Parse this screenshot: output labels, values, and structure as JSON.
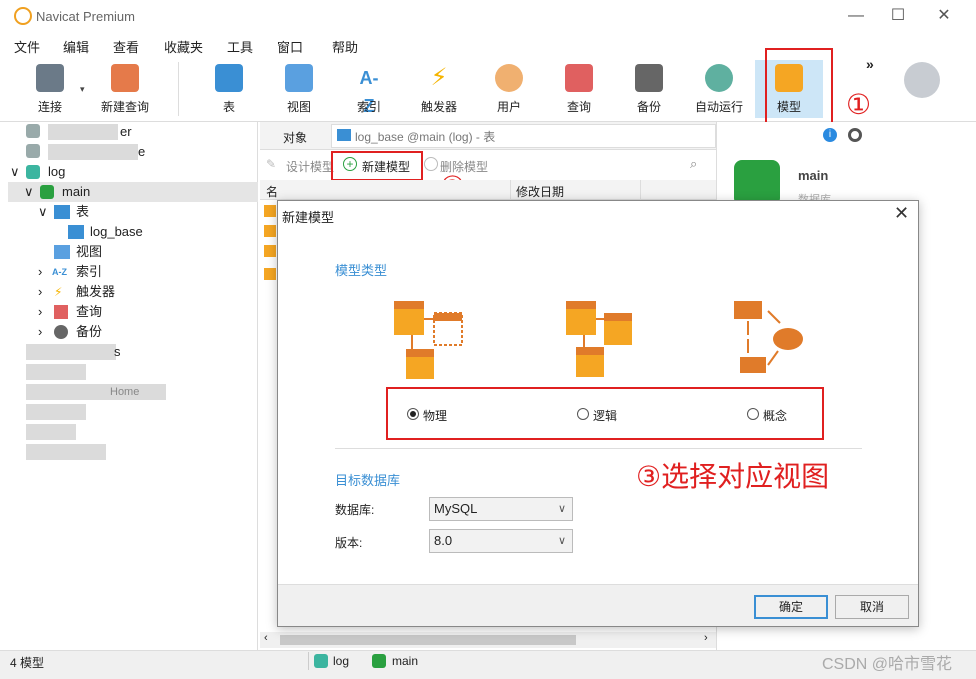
{
  "app": {
    "title": "Navicat Premium"
  },
  "window_controls": {
    "minimize": "—",
    "maximize": "☐",
    "close": "✕"
  },
  "menu": [
    "文件",
    "编辑",
    "查看",
    "收藏夹",
    "工具",
    "窗口",
    "帮助"
  ],
  "toolbar": {
    "connect": "连接",
    "new_query": "新建查询",
    "items": [
      "表",
      "视图",
      "索引",
      "触发器",
      "用户",
      "查询",
      "备份",
      "自动运行",
      "模型"
    ],
    "more": "»"
  },
  "sidebar": {
    "partial_text_1": "er",
    "partial_text_2": "e",
    "log": "log",
    "main": "main",
    "table_group": "表",
    "table_item": "log_base",
    "view": "视图",
    "index": "索引",
    "trigger": "触发器",
    "query": "查询",
    "backup": "备份",
    "partial_text_3": "s",
    "partial_text_4": "Home"
  },
  "objects": {
    "tab_label": "对象",
    "tab_title": "log_base @main (log) - 表",
    "design_model": "设计模型",
    "new_model": "新建模型",
    "delete_model": "删除模型",
    "col_name": "名",
    "col_modified": "修改日期"
  },
  "right_panel": {
    "db_name": "main",
    "db_sub": "数据库"
  },
  "status": {
    "count": "4 模型",
    "conn": "log",
    "db": "main",
    "watermark": "CSDN @哈市雪花"
  },
  "dialog": {
    "title": "新建模型",
    "close": "✕",
    "model_type": "模型类型",
    "options": [
      "物理",
      "逻辑",
      "概念"
    ],
    "selected": "物理",
    "target_db": "目标数据库",
    "db_label": "数据库:",
    "db_value": "MySQL",
    "version_label": "版本:",
    "version_value": "8.0",
    "ok": "确定",
    "cancel": "取消"
  },
  "annotations": {
    "a1": "①",
    "a2": "②",
    "a3": "③选择对应视图"
  },
  "colors": {
    "accent": "#3a8fd4",
    "annotation": "#e02020",
    "model_orange": "#f5a623"
  }
}
